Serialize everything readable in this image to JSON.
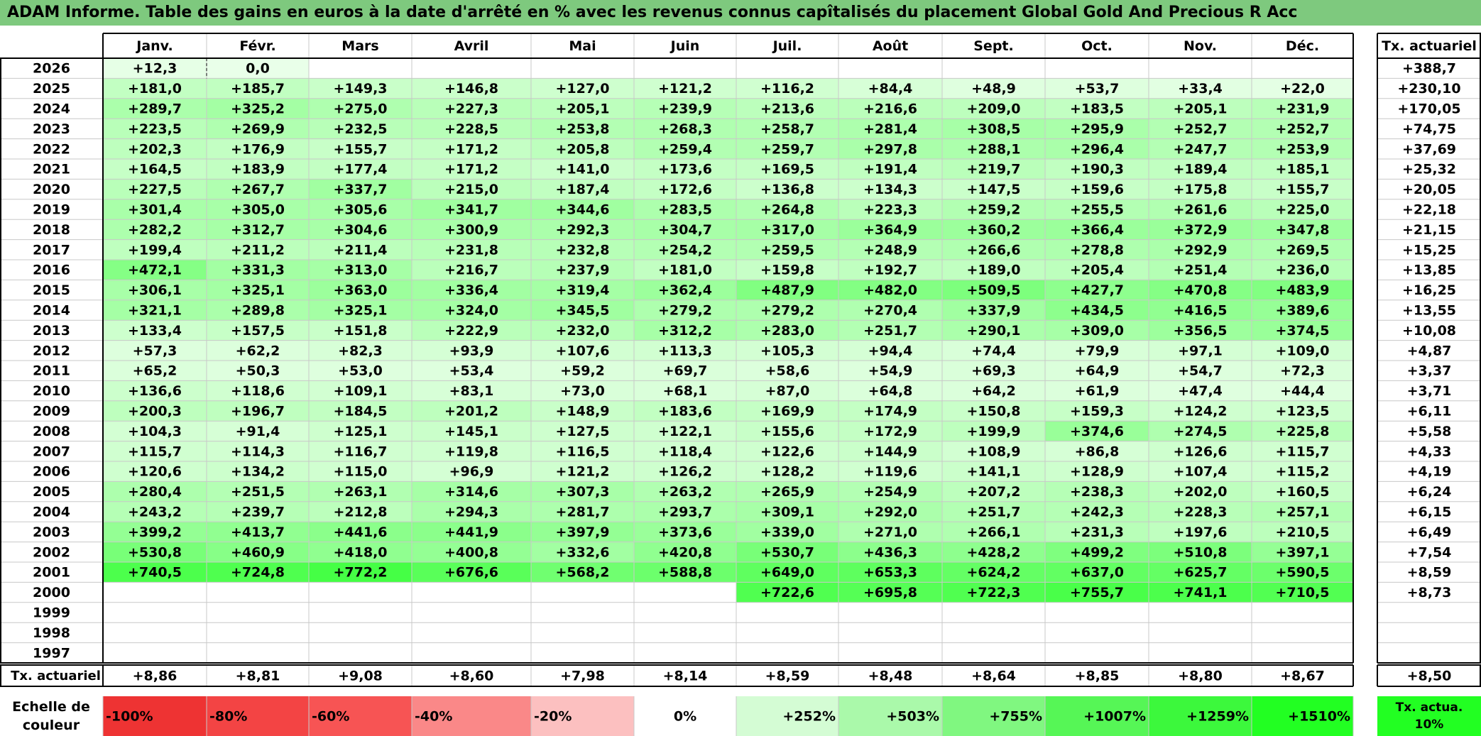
{
  "title": "ADAM Informe. Table des gains en euros à la date d'arrêté en % avec les revenus connus capîtalisés du placement Global Gold And Precious R Acc",
  "colors": {
    "title_bg": "#7ec97e",
    "positive_max": "#22ff22",
    "negative_max": "#ee3333"
  },
  "chart_data": {
    "type": "table",
    "months": [
      "Janv.",
      "Févr.",
      "Mars",
      "Avril",
      "Mai",
      "Juin",
      "Juil.",
      "Août",
      "Sept.",
      "Oct.",
      "Nov.",
      "Déc."
    ],
    "rate_header": "Tx. actuariel",
    "rows": [
      {
        "year": "2026",
        "values": [
          "+12,3",
          "0,0",
          "",
          "",
          "",
          "",
          "",
          "",
          "",
          "",
          "",
          ""
        ],
        "rate": "+388,7"
      },
      {
        "year": "2025",
        "values": [
          "+181,0",
          "+185,7",
          "+149,3",
          "+146,8",
          "+127,0",
          "+121,2",
          "+116,2",
          "+84,4",
          "+48,9",
          "+53,7",
          "+33,4",
          "+22,0"
        ],
        "rate": "+230,10"
      },
      {
        "year": "2024",
        "values": [
          "+289,7",
          "+325,2",
          "+275,0",
          "+227,3",
          "+205,1",
          "+239,9",
          "+213,6",
          "+216,6",
          "+209,0",
          "+183,5",
          "+205,1",
          "+231,9"
        ],
        "rate": "+170,05"
      },
      {
        "year": "2023",
        "values": [
          "+223,5",
          "+269,9",
          "+232,5",
          "+228,5",
          "+253,8",
          "+268,3",
          "+258,7",
          "+281,4",
          "+308,5",
          "+295,9",
          "+252,7",
          "+252,7"
        ],
        "rate": "+74,75"
      },
      {
        "year": "2022",
        "values": [
          "+202,3",
          "+176,9",
          "+155,7",
          "+171,2",
          "+205,8",
          "+259,4",
          "+259,7",
          "+297,8",
          "+288,1",
          "+296,4",
          "+247,7",
          "+253,9"
        ],
        "rate": "+37,69"
      },
      {
        "year": "2021",
        "values": [
          "+164,5",
          "+183,9",
          "+177,4",
          "+171,2",
          "+141,0",
          "+173,6",
          "+169,5",
          "+191,4",
          "+219,7",
          "+190,3",
          "+189,4",
          "+185,1"
        ],
        "rate": "+25,32"
      },
      {
        "year": "2020",
        "values": [
          "+227,5",
          "+267,7",
          "+337,7",
          "+215,0",
          "+187,4",
          "+172,6",
          "+136,8",
          "+134,3",
          "+147,5",
          "+159,6",
          "+175,8",
          "+155,7"
        ],
        "rate": "+20,05"
      },
      {
        "year": "2019",
        "values": [
          "+301,4",
          "+305,0",
          "+305,6",
          "+341,7",
          "+344,6",
          "+283,5",
          "+264,8",
          "+223,3",
          "+259,2",
          "+255,5",
          "+261,6",
          "+225,0"
        ],
        "rate": "+22,18"
      },
      {
        "year": "2018",
        "values": [
          "+282,2",
          "+312,7",
          "+304,6",
          "+300,9",
          "+292,3",
          "+304,7",
          "+317,0",
          "+364,9",
          "+360,2",
          "+366,4",
          "+372,9",
          "+347,8"
        ],
        "rate": "+21,15"
      },
      {
        "year": "2017",
        "values": [
          "+199,4",
          "+211,2",
          "+211,4",
          "+231,8",
          "+232,8",
          "+254,2",
          "+259,5",
          "+248,9",
          "+266,6",
          "+278,8",
          "+292,9",
          "+269,5"
        ],
        "rate": "+15,25"
      },
      {
        "year": "2016",
        "values": [
          "+472,1",
          "+331,3",
          "+313,0",
          "+216,7",
          "+237,9",
          "+181,0",
          "+159,8",
          "+192,7",
          "+189,0",
          "+205,4",
          "+251,4",
          "+236,0"
        ],
        "rate": "+13,85"
      },
      {
        "year": "2015",
        "values": [
          "+306,1",
          "+325,1",
          "+363,0",
          "+336,4",
          "+319,4",
          "+362,4",
          "+487,9",
          "+482,0",
          "+509,5",
          "+427,7",
          "+470,8",
          "+483,9"
        ],
        "rate": "+16,25"
      },
      {
        "year": "2014",
        "values": [
          "+321,1",
          "+289,8",
          "+325,1",
          "+324,0",
          "+345,5",
          "+279,2",
          "+279,2",
          "+270,4",
          "+337,9",
          "+434,5",
          "+416,5",
          "+389,6"
        ],
        "rate": "+13,55"
      },
      {
        "year": "2013",
        "values": [
          "+133,4",
          "+157,5",
          "+151,8",
          "+222,9",
          "+232,0",
          "+312,2",
          "+283,0",
          "+251,7",
          "+290,1",
          "+309,0",
          "+356,5",
          "+374,5"
        ],
        "rate": "+10,08"
      },
      {
        "year": "2012",
        "values": [
          "+57,3",
          "+62,2",
          "+82,3",
          "+93,9",
          "+107,6",
          "+113,3",
          "+105,3",
          "+94,4",
          "+74,4",
          "+79,9",
          "+97,1",
          "+109,0"
        ],
        "rate": "+4,87"
      },
      {
        "year": "2011",
        "values": [
          "+65,2",
          "+50,3",
          "+53,0",
          "+53,4",
          "+59,2",
          "+69,7",
          "+58,6",
          "+54,9",
          "+69,3",
          "+64,9",
          "+54,7",
          "+72,3"
        ],
        "rate": "+3,37"
      },
      {
        "year": "2010",
        "values": [
          "+136,6",
          "+118,6",
          "+109,1",
          "+83,1",
          "+73,0",
          "+68,1",
          "+87,0",
          "+64,8",
          "+64,2",
          "+61,9",
          "+47,4",
          "+44,4"
        ],
        "rate": "+3,71"
      },
      {
        "year": "2009",
        "values": [
          "+200,3",
          "+196,7",
          "+184,5",
          "+201,2",
          "+148,9",
          "+183,6",
          "+169,9",
          "+174,9",
          "+150,8",
          "+159,3",
          "+124,2",
          "+123,5"
        ],
        "rate": "+6,11"
      },
      {
        "year": "2008",
        "values": [
          "+104,3",
          "+91,4",
          "+125,1",
          "+145,1",
          "+127,5",
          "+122,1",
          "+155,6",
          "+172,9",
          "+199,9",
          "+374,6",
          "+274,5",
          "+225,8"
        ],
        "rate": "+5,58"
      },
      {
        "year": "2007",
        "values": [
          "+115,7",
          "+114,3",
          "+116,7",
          "+119,8",
          "+116,5",
          "+118,4",
          "+122,6",
          "+144,9",
          "+108,9",
          "+86,8",
          "+126,6",
          "+115,7"
        ],
        "rate": "+4,33"
      },
      {
        "year": "2006",
        "values": [
          "+120,6",
          "+134,2",
          "+115,0",
          "+96,9",
          "+121,2",
          "+126,2",
          "+128,2",
          "+119,6",
          "+141,1",
          "+128,9",
          "+107,4",
          "+115,2"
        ],
        "rate": "+4,19"
      },
      {
        "year": "2005",
        "values": [
          "+280,4",
          "+251,5",
          "+263,1",
          "+314,6",
          "+307,3",
          "+263,2",
          "+265,9",
          "+254,9",
          "+207,2",
          "+238,3",
          "+202,0",
          "+160,5"
        ],
        "rate": "+6,24"
      },
      {
        "year": "2004",
        "values": [
          "+243,2",
          "+239,7",
          "+212,8",
          "+294,3",
          "+281,7",
          "+293,7",
          "+309,1",
          "+292,0",
          "+251,7",
          "+242,3",
          "+228,3",
          "+257,1"
        ],
        "rate": "+6,15"
      },
      {
        "year": "2003",
        "values": [
          "+399,2",
          "+413,7",
          "+441,6",
          "+441,9",
          "+397,9",
          "+373,6",
          "+339,0",
          "+271,0",
          "+266,1",
          "+231,3",
          "+197,6",
          "+210,5"
        ],
        "rate": "+6,49"
      },
      {
        "year": "2002",
        "values": [
          "+530,8",
          "+460,9",
          "+418,0",
          "+400,8",
          "+332,6",
          "+420,8",
          "+530,7",
          "+436,3",
          "+428,2",
          "+499,2",
          "+510,8",
          "+397,1"
        ],
        "rate": "+7,54"
      },
      {
        "year": "2001",
        "values": [
          "+740,5",
          "+724,8",
          "+772,2",
          "+676,6",
          "+568,2",
          "+588,8",
          "+649,0",
          "+653,3",
          "+624,2",
          "+637,0",
          "+625,7",
          "+590,5"
        ],
        "rate": "+8,59"
      },
      {
        "year": "2000",
        "values": [
          "",
          "",
          "",
          "",
          "",
          "",
          "+722,6",
          "+695,8",
          "+722,3",
          "+755,7",
          "+741,1",
          "+710,5"
        ],
        "rate": "+8,73"
      },
      {
        "year": "1999",
        "values": [
          "",
          "",
          "",
          "",
          "",
          "",
          "",
          "",
          "",
          "",
          "",
          ""
        ],
        "rate": ""
      },
      {
        "year": "1998",
        "values": [
          "",
          "",
          "",
          "",
          "",
          "",
          "",
          "",
          "",
          "",
          "",
          ""
        ],
        "rate": ""
      },
      {
        "year": "1997",
        "values": [
          "",
          "",
          "",
          "",
          "",
          "",
          "",
          "",
          "",
          "",
          "",
          ""
        ],
        "rate": ""
      }
    ],
    "footer": {
      "label": "Tx. actuariel",
      "values": [
        "+8,86",
        "+8,81",
        "+9,08",
        "+8,60",
        "+7,98",
        "+8,14",
        "+8,59",
        "+8,48",
        "+8,64",
        "+8,85",
        "+8,80",
        "+8,67"
      ],
      "rate": "+8,50"
    },
    "legend": {
      "label": "Echelle de couleur",
      "steps": [
        {
          "text": "-100%",
          "color": "#ee3333"
        },
        {
          "text": "-80%",
          "color": "#f34444"
        },
        {
          "text": "-60%",
          "color": "#f75454"
        },
        {
          "text": "-40%",
          "color": "#fa8888"
        },
        {
          "text": "-20%",
          "color": "#fcc0c0"
        },
        {
          "text": "0%",
          "color": "#ffffff"
        },
        {
          "text": "+252%",
          "color": "#d4fcd4"
        },
        {
          "text": "+503%",
          "color": "#aaf9aa"
        },
        {
          "text": "+755%",
          "color": "#80f780"
        },
        {
          "text": "+1007%",
          "color": "#56f656"
        },
        {
          "text": "+1259%",
          "color": "#3cf83c"
        },
        {
          "text": "+1510%",
          "color": "#22ff22"
        }
      ],
      "rate_label": "Tx. actua. 10%",
      "scale_max": 1510
    }
  }
}
